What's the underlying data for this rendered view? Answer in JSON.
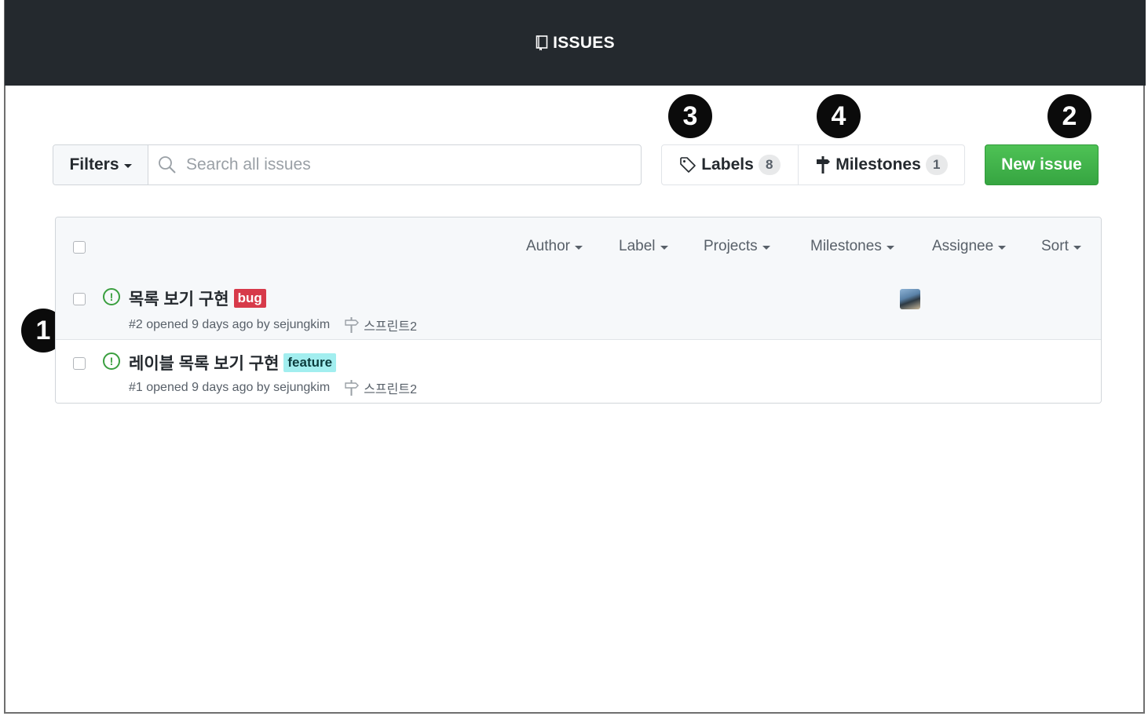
{
  "header": {
    "title": "ISSUES",
    "icon": "book-icon"
  },
  "markers": [
    "1",
    "2",
    "3",
    "4"
  ],
  "toolbar": {
    "filters_label": "Filters",
    "search_placeholder": "Search all issues",
    "labels_label": "Labels",
    "labels_count": "8",
    "milestones_label": "Milestones",
    "milestones_count": "1",
    "new_issue_label": "New issue",
    "new_issue_color": "#3fb34a"
  },
  "list_header": {
    "filters": [
      "Author",
      "Label",
      "Projects",
      "Milestones",
      "Assignee",
      "Sort"
    ]
  },
  "issues": [
    {
      "title": "목록 보기 구현",
      "label": "bug",
      "label_color": "#d73a4a",
      "meta": "#2 opened 9 days ago by sejungkim",
      "milestone": "스프린트2",
      "has_assignee_avatar": true
    },
    {
      "title": "레이블 목록 보기 구현",
      "label": "feature",
      "label_color": "#a2eeef",
      "meta": "#1 opened 9 days ago by sejungkim",
      "milestone": "스프린트2",
      "has_assignee_avatar": false
    }
  ]
}
